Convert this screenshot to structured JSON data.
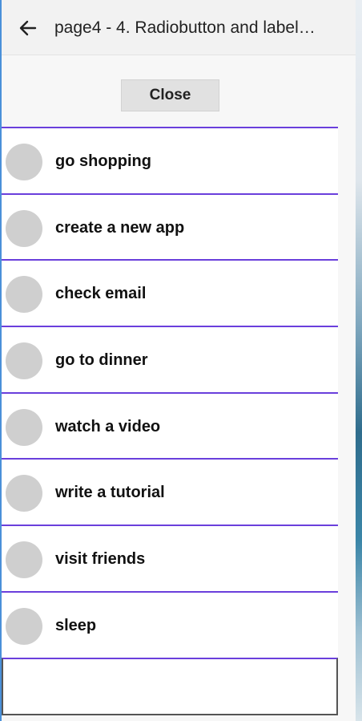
{
  "header": {
    "back_icon": "arrow-left-icon",
    "title": "page4 - 4. Radiobutton and label…"
  },
  "close_button": {
    "label": "Close"
  },
  "options": [
    {
      "label": "go shopping",
      "checked": false
    },
    {
      "label": "create a new app",
      "checked": false
    },
    {
      "label": "check email",
      "checked": false
    },
    {
      "label": "go to dinner",
      "checked": false
    },
    {
      "label": "watch a video",
      "checked": false
    },
    {
      "label": "write a tutorial",
      "checked": false
    },
    {
      "label": "visit friends",
      "checked": false
    },
    {
      "label": "sleep",
      "checked": false
    }
  ],
  "entry": {
    "value": ""
  },
  "colors": {
    "divider": "#6a3fdc",
    "radio": "#cfcfcf",
    "window_border": "#4a90d9"
  }
}
